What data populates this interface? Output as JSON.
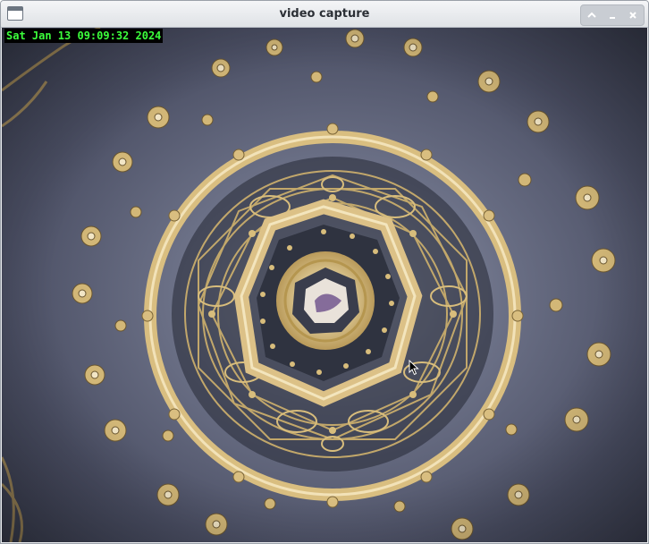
{
  "window": {
    "title": "video capture"
  },
  "overlay": {
    "timestamp": "Sat Jan 13 09:09:32 2024"
  },
  "controls": {
    "icons": [
      "chevron-up-icon",
      "minimize-icon",
      "close-icon"
    ]
  },
  "colors": {
    "timestamp_text": "#3cff3c",
    "timestamp_bg": "#000000",
    "gold": "#d8bd7c",
    "background": "#5a5e74"
  }
}
